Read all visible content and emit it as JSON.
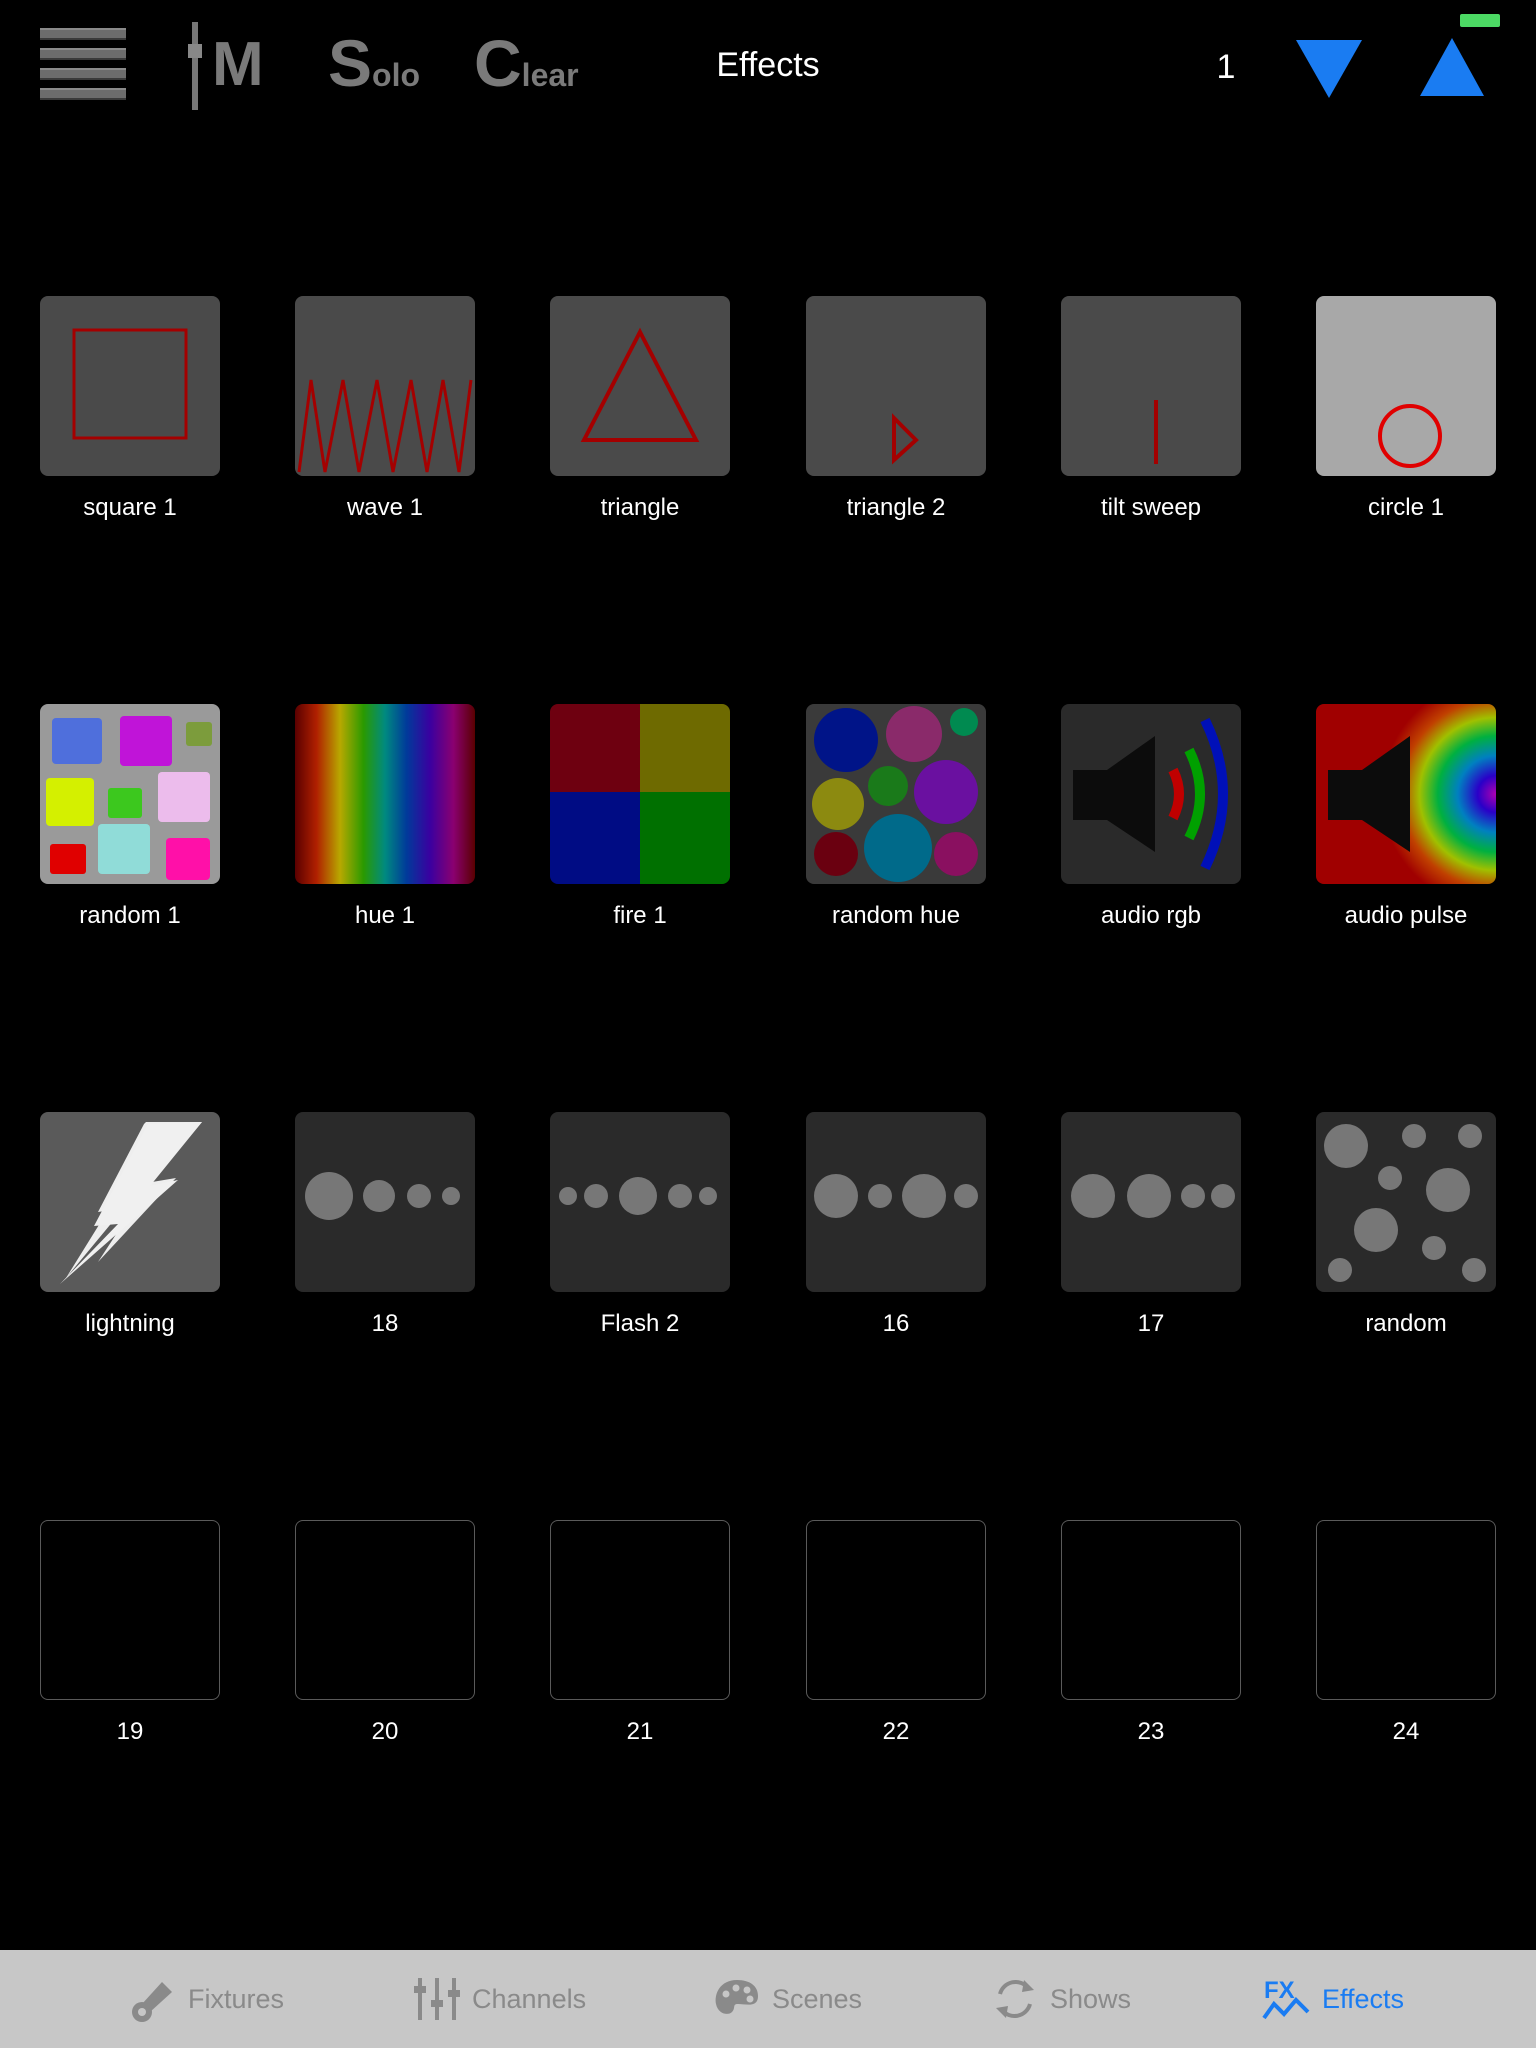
{
  "header": {
    "title": "Effects",
    "master_label": "M",
    "solo": {
      "big": "S",
      "small": "olo"
    },
    "clear": {
      "big": "C",
      "small": "lear"
    },
    "page_number": "1"
  },
  "colors": {
    "accent": "#1a7cf2",
    "battery": "#4cd964",
    "tab_inactive": "#8a8a8a",
    "tab_bar": "#c7c7c7"
  },
  "effects": [
    {
      "label": "square 1",
      "icon": "red-square-outline"
    },
    {
      "label": "wave 1",
      "icon": "red-zigzag-wave"
    },
    {
      "label": "triangle",
      "icon": "red-triangle-outline"
    },
    {
      "label": "triangle 2",
      "icon": "small-red-triangle"
    },
    {
      "label": "tilt sweep",
      "icon": "red-vertical-line"
    },
    {
      "label": "circle 1",
      "icon": "red-circle-outline"
    },
    {
      "label": "random 1",
      "icon": "random-color-squares"
    },
    {
      "label": "hue 1",
      "icon": "rainbow-gradient"
    },
    {
      "label": "fire 1",
      "icon": "four-color-quadrants"
    },
    {
      "label": "random hue",
      "icon": "colored-circles"
    },
    {
      "label": "audio rgb",
      "icon": "speaker-rgb-waves"
    },
    {
      "label": "audio pulse",
      "icon": "speaker-rainbow-pulse"
    },
    {
      "label": "lightning",
      "icon": "lightning-bolt"
    },
    {
      "label": "18",
      "icon": "grey-dots"
    },
    {
      "label": "Flash 2",
      "icon": "grey-dots"
    },
    {
      "label": "16",
      "icon": "grey-dots"
    },
    {
      "label": "17",
      "icon": "grey-dots"
    },
    {
      "label": "random",
      "icon": "scattered-grey-dots"
    },
    {
      "label": "19",
      "icon": "empty-slot"
    },
    {
      "label": "20",
      "icon": "empty-slot"
    },
    {
      "label": "21",
      "icon": "empty-slot"
    },
    {
      "label": "22",
      "icon": "empty-slot"
    },
    {
      "label": "23",
      "icon": "empty-slot"
    },
    {
      "label": "24",
      "icon": "empty-slot"
    }
  ],
  "tabs": [
    {
      "label": "Fixtures",
      "icon": "spotlight-icon",
      "active": false
    },
    {
      "label": "Channels",
      "icon": "sliders-icon",
      "active": false
    },
    {
      "label": "Scenes",
      "icon": "palette-icon",
      "active": false
    },
    {
      "label": "Shows",
      "icon": "cycle-arrows-icon",
      "active": false
    },
    {
      "label": "Effects",
      "icon": "fx-icon",
      "active": true
    }
  ]
}
